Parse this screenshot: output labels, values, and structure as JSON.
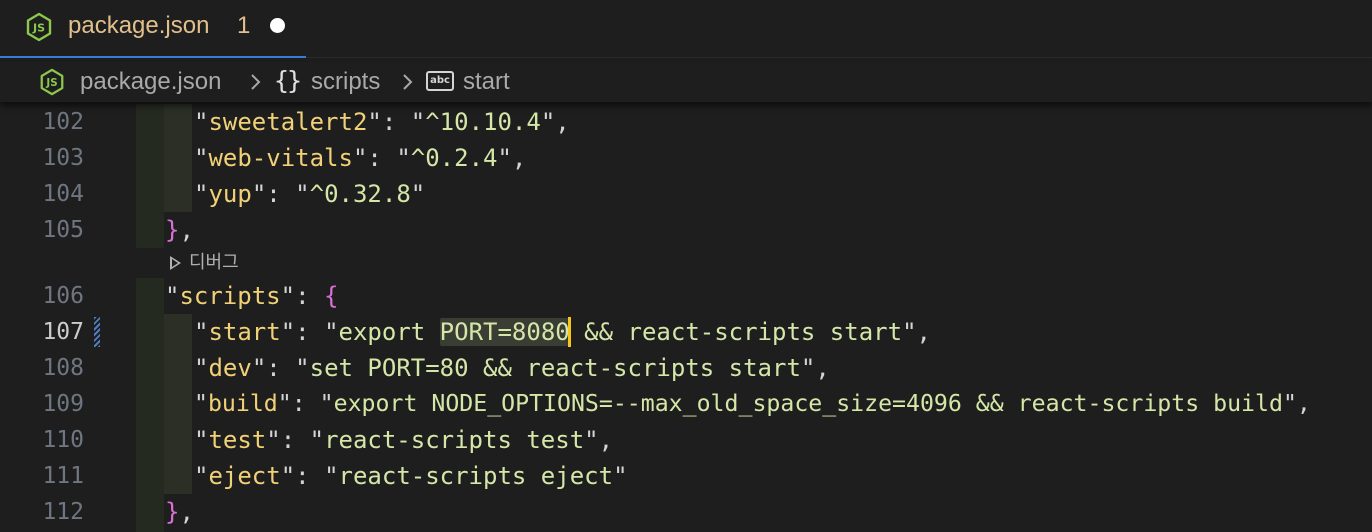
{
  "tab": {
    "title": "package.json",
    "badge": "1",
    "icon": "nodejs-icon"
  },
  "breadcrumb": {
    "file": "package.json",
    "braces": "{}",
    "scripts": "scripts",
    "abc": "abc",
    "start": "start"
  },
  "editor": {
    "codelens_label": "디버그",
    "lines": [
      {
        "num": "102",
        "key": "sweetalert2",
        "value": "^10.10.4",
        "trail": ","
      },
      {
        "num": "103",
        "key": "web-vitals",
        "value": "^0.2.4",
        "trail": ","
      },
      {
        "num": "104",
        "key": "yup",
        "value": "^0.32.8",
        "trail": ""
      },
      {
        "num": "105",
        "close": "}",
        "trail": ","
      },
      {
        "num": "106",
        "key": "scripts",
        "open": "{"
      },
      {
        "num": "107",
        "key": "start",
        "value_pre": "export ",
        "value_hl": "PORT=8080",
        "value_post": " && react-scripts start",
        "trail": ","
      },
      {
        "num": "108",
        "key": "dev",
        "value": "set PORT=80 && react-scripts start",
        "trail": ","
      },
      {
        "num": "109",
        "key": "build",
        "value": "export NODE_OPTIONS=--max_old_space_size=4096 && react-scripts build",
        "trail": ","
      },
      {
        "num": "110",
        "key": "test",
        "value": "react-scripts test",
        "trail": ","
      },
      {
        "num": "111",
        "key": "eject",
        "value": "react-scripts eject",
        "trail": ""
      },
      {
        "num": "112",
        "close": "}",
        "trail": ","
      }
    ]
  },
  "colors": {
    "background": "#1e1e1e",
    "tab_title": "#e2c08d",
    "json_key": "#f1d178",
    "json_string": "#d4e6a8",
    "bracket": "#da70d6",
    "line_number": "#6e7681",
    "cursor": "#f5c518"
  }
}
